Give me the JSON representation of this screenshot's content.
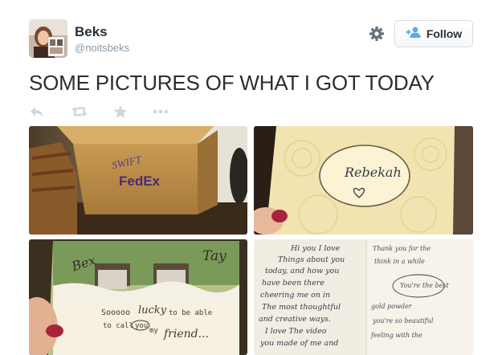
{
  "user": {
    "name": "Beks",
    "handle": "@noitsbeks"
  },
  "follow_button": {
    "label": "Follow",
    "icon": "add-user-icon"
  },
  "settings": {
    "icon": "gear-icon"
  },
  "tweet": {
    "text": "SOME PICTURES OF WHAT I GOT TODAY"
  },
  "actions": [
    {
      "name": "reply",
      "icon": "reply-icon"
    },
    {
      "name": "retweet",
      "icon": "retweet-icon"
    },
    {
      "name": "favorite",
      "icon": "star-icon"
    },
    {
      "name": "more",
      "icon": "more-icon"
    }
  ],
  "photos": {
    "box": {
      "label_top": "SWIFT",
      "label_brand": "FedEx"
    },
    "card": {
      "name": "Rebekah"
    },
    "photo_card": {
      "left_name": "Bex",
      "right_name": "Tay",
      "line1_a": "Sooooo",
      "line1_b": "lucky",
      "line1_c": "to be able",
      "line2_a": "to call",
      "line2_b": "you",
      "line2_c": "my",
      "line3": "friend..."
    },
    "letter": {
      "lines": [
        "Hi you I love",
        "Things about you",
        "today, and how you",
        "have been there",
        "cheering me on in",
        "The most thoughtful",
        "and creative ways.",
        "I love The video",
        "you made of me and"
      ],
      "right_lines": [
        "Thank you for the",
        "think in a while",
        "You're the best",
        "gold powder",
        "you're so beautiful",
        "feeling with the"
      ]
    }
  },
  "colors": {
    "text": "#292f33",
    "muted": "#8899a6",
    "follow_icon": "#55acee",
    "action_icons": "#ccd6dd"
  }
}
